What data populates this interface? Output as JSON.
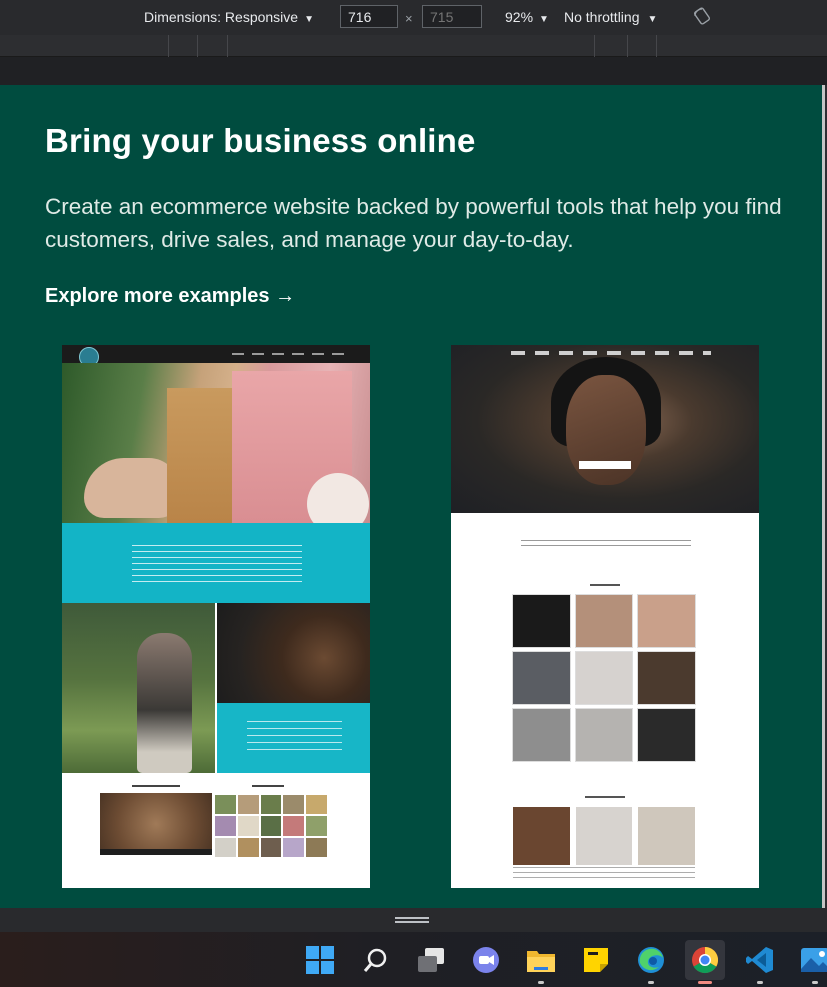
{
  "devtools": {
    "dimensions_label": "Dimensions: Responsive",
    "width_value": "716",
    "times": "×",
    "height_placeholder": "715",
    "zoom_label": "92%",
    "throttling_label": "No throttling",
    "caret": "▼"
  },
  "page": {
    "headline": "Bring your business online",
    "subheading": "Create an ecommerce website backed by powerful tools that help you find customers, drive sales, and manage your day-to-day.",
    "explore_link": "Explore more examples →",
    "colors": {
      "background": "#004c3f",
      "text": "#ffffff"
    }
  },
  "examples": [
    {
      "name": "coffee-store-example",
      "accent": "#13b4c6"
    },
    {
      "name": "jewelry-store-example",
      "accent": "#1e2025"
    }
  ],
  "taskbar": {
    "icons": [
      "windows-start-icon",
      "search-icon",
      "task-view-icon",
      "teams-chat-icon",
      "file-explorer-icon",
      "sticky-notes-icon",
      "edge-icon",
      "chrome-icon",
      "vscode-icon",
      "photos-icon"
    ]
  }
}
